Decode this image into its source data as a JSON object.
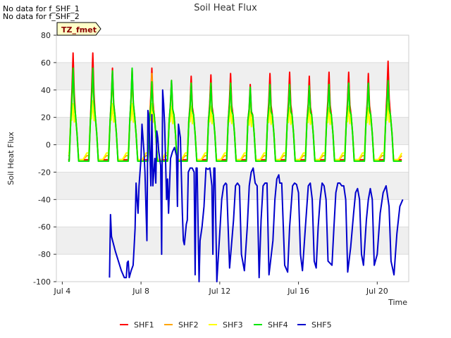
{
  "notes": [
    "No data for f_SHF_1",
    "No data for f_SHF_2"
  ],
  "chart_data": {
    "type": "line",
    "title": "Soil Heat Flux",
    "xlabel": "Time",
    "ylabel": "Soil Heat Flux",
    "tag": "TZ_fmet",
    "ylim": [
      -100,
      80
    ],
    "yticks": [
      -100,
      -80,
      -60,
      -40,
      -20,
      0,
      20,
      40,
      60,
      80
    ],
    "xlim_days": [
      3.7,
      21.6
    ],
    "xticks": [
      {
        "day": 4,
        "label": "Jul 4"
      },
      {
        "day": 8,
        "label": "Jul 8"
      },
      {
        "day": 12,
        "label": "Jul 12"
      },
      {
        "day": 16,
        "label": "Jul 16"
      },
      {
        "day": 20,
        "label": "Jul 20"
      }
    ],
    "grid": "horizontal bands",
    "legend": "bottom",
    "series": [
      {
        "name": "SHF1",
        "color": "#ff0000",
        "peaks": [
          67,
          67,
          56,
          55,
          56,
          47,
          50,
          51,
          52,
          44,
          52,
          53,
          50,
          53,
          53,
          52,
          61
        ],
        "trough": -11,
        "night": -11
      },
      {
        "name": "SHF2",
        "color": "#ffa500",
        "peaks": [
          52,
          52,
          50,
          50,
          52,
          44,
          45,
          45,
          45,
          38,
          43,
          44,
          43,
          44,
          45,
          44,
          46
        ],
        "trough": -11,
        "night": -8
      },
      {
        "name": "SHF3",
        "color": "#ffff00",
        "peaks": [
          30,
          32,
          30,
          30,
          30,
          28,
          28,
          28,
          28,
          24,
          27,
          27,
          27,
          27,
          28,
          27,
          30
        ],
        "trough": -11,
        "night": -6
      },
      {
        "name": "SHF4",
        "color": "#00e600",
        "peaks": [
          56,
          56,
          54,
          56,
          46,
          47,
          45,
          45,
          45,
          42,
          44,
          44,
          43,
          44,
          45,
          45,
          47
        ],
        "trough": -12,
        "night": -12
      },
      {
        "name": "SHF5",
        "color": "#0000cc",
        "points": [
          [
            6.4,
            -97
          ],
          [
            6.45,
            -51
          ],
          [
            6.5,
            -67
          ],
          [
            6.7,
            -78
          ],
          [
            7.0,
            -92
          ],
          [
            7.15,
            -97
          ],
          [
            7.25,
            -97
          ],
          [
            7.3,
            -86
          ],
          [
            7.35,
            -85
          ],
          [
            7.4,
            -97
          ],
          [
            7.5,
            -92
          ],
          [
            7.6,
            -88
          ],
          [
            7.65,
            -75
          ],
          [
            7.7,
            -61
          ],
          [
            7.75,
            -28
          ],
          [
            7.8,
            -40
          ],
          [
            7.85,
            -50
          ],
          [
            7.9,
            -30
          ],
          [
            8.0,
            -10
          ],
          [
            8.05,
            15
          ],
          [
            8.1,
            5
          ],
          [
            8.15,
            -5
          ],
          [
            8.2,
            -20
          ],
          [
            8.3,
            -70
          ],
          [
            8.35,
            25
          ],
          [
            8.4,
            20
          ],
          [
            8.45,
            -5
          ],
          [
            8.5,
            -30
          ],
          [
            8.55,
            22
          ],
          [
            8.6,
            -30
          ],
          [
            8.65,
            -20
          ],
          [
            8.7,
            -10
          ],
          [
            8.75,
            -28
          ],
          [
            8.8,
            10
          ],
          [
            8.85,
            5
          ],
          [
            8.9,
            -5
          ],
          [
            9.0,
            -15
          ],
          [
            9.05,
            -80
          ],
          [
            9.1,
            40
          ],
          [
            9.15,
            30
          ],
          [
            9.2,
            15
          ],
          [
            9.3,
            -40
          ],
          [
            9.35,
            -25
          ],
          [
            9.4,
            -50
          ],
          [
            9.5,
            -10
          ],
          [
            9.6,
            -5
          ],
          [
            9.7,
            -2
          ],
          [
            9.8,
            -8
          ],
          [
            9.85,
            -45
          ],
          [
            9.9,
            15
          ],
          [
            9.95,
            10
          ],
          [
            10.0,
            5
          ],
          [
            10.1,
            -50
          ],
          [
            10.15,
            -70
          ],
          [
            10.2,
            -73
          ],
          [
            10.3,
            -58
          ],
          [
            10.35,
            -55
          ],
          [
            10.4,
            -20
          ],
          [
            10.5,
            -17
          ],
          [
            10.6,
            -17
          ],
          [
            10.7,
            -20
          ],
          [
            10.75,
            -95
          ],
          [
            10.8,
            -17
          ],
          [
            10.85,
            -17
          ],
          [
            10.95,
            -100
          ],
          [
            11.0,
            -70
          ],
          [
            11.1,
            -60
          ],
          [
            11.2,
            -45
          ],
          [
            11.3,
            -17
          ],
          [
            11.4,
            -18
          ],
          [
            11.5,
            -17
          ],
          [
            11.6,
            -30
          ],
          [
            11.65,
            -80
          ],
          [
            11.7,
            -17
          ],
          [
            11.75,
            -17
          ],
          [
            11.85,
            -100
          ],
          [
            12.0,
            -65
          ],
          [
            12.1,
            -40
          ],
          [
            12.2,
            -30
          ],
          [
            12.3,
            -28
          ],
          [
            12.35,
            -29
          ],
          [
            12.5,
            -90
          ],
          [
            12.7,
            -55
          ],
          [
            12.8,
            -30
          ],
          [
            12.9,
            -28
          ],
          [
            13.0,
            -30
          ],
          [
            13.1,
            -80
          ],
          [
            13.25,
            -92
          ],
          [
            13.4,
            -60
          ],
          [
            13.5,
            -30
          ],
          [
            13.6,
            -20
          ],
          [
            13.7,
            -17
          ],
          [
            13.8,
            -28
          ],
          [
            13.9,
            -30
          ],
          [
            14.0,
            -97
          ],
          [
            14.1,
            -55
          ],
          [
            14.2,
            -30
          ],
          [
            14.3,
            -28
          ],
          [
            14.4,
            -28
          ],
          [
            14.5,
            -95
          ],
          [
            14.7,
            -70
          ],
          [
            14.8,
            -40
          ],
          [
            14.9,
            -25
          ],
          [
            15.0,
            -22
          ],
          [
            15.05,
            -28
          ],
          [
            15.15,
            -28
          ],
          [
            15.3,
            -88
          ],
          [
            15.45,
            -93
          ],
          [
            15.55,
            -60
          ],
          [
            15.7,
            -30
          ],
          [
            15.8,
            -28
          ],
          [
            15.9,
            -29
          ],
          [
            16.0,
            -35
          ],
          [
            16.1,
            -80
          ],
          [
            16.2,
            -92
          ],
          [
            16.35,
            -60
          ],
          [
            16.5,
            -30
          ],
          [
            16.6,
            -28
          ],
          [
            16.7,
            -40
          ],
          [
            16.8,
            -85
          ],
          [
            16.9,
            -90
          ],
          [
            17.0,
            -60
          ],
          [
            17.1,
            -40
          ],
          [
            17.2,
            -28
          ],
          [
            17.3,
            -30
          ],
          [
            17.4,
            -40
          ],
          [
            17.5,
            -85
          ],
          [
            17.7,
            -88
          ],
          [
            17.8,
            -60
          ],
          [
            17.9,
            -35
          ],
          [
            18.0,
            -28
          ],
          [
            18.1,
            -28
          ],
          [
            18.2,
            -30
          ],
          [
            18.3,
            -30
          ],
          [
            18.4,
            -40
          ],
          [
            18.5,
            -93
          ],
          [
            18.65,
            -75
          ],
          [
            18.8,
            -50
          ],
          [
            18.9,
            -35
          ],
          [
            19.0,
            -32
          ],
          [
            19.1,
            -40
          ],
          [
            19.2,
            -80
          ],
          [
            19.3,
            -88
          ],
          [
            19.45,
            -55
          ],
          [
            19.55,
            -40
          ],
          [
            19.65,
            -32
          ],
          [
            19.75,
            -40
          ],
          [
            19.85,
            -88
          ],
          [
            20.0,
            -80
          ],
          [
            20.15,
            -50
          ],
          [
            20.3,
            -35
          ],
          [
            20.45,
            -30
          ],
          [
            20.6,
            -45
          ],
          [
            20.7,
            -85
          ],
          [
            20.85,
            -95
          ],
          [
            21.0,
            -65
          ],
          [
            21.15,
            -45
          ],
          [
            21.3,
            -40
          ]
        ]
      }
    ]
  }
}
